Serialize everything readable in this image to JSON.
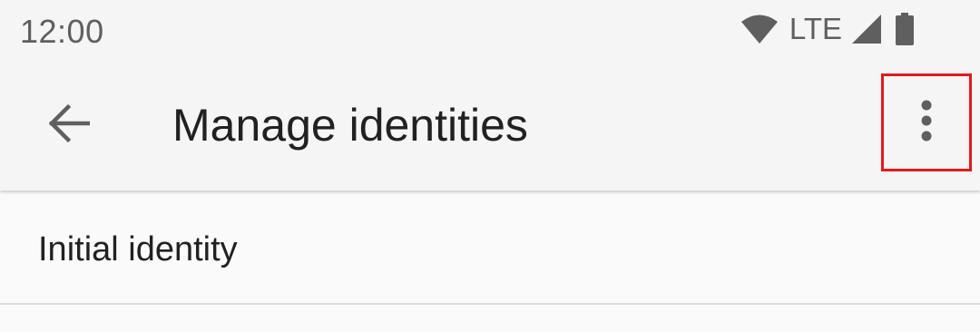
{
  "status_bar": {
    "time": "12:00",
    "network": "LTE",
    "icons": [
      "wifi-icon",
      "signal-icon",
      "battery-icon"
    ]
  },
  "app_bar": {
    "title": "Manage identities",
    "back_icon": "arrow-back-icon",
    "overflow_icon": "more-vert-icon"
  },
  "identities": [
    {
      "label": "Initial identity"
    }
  ],
  "colors": {
    "background": "#f5f5f5",
    "text_primary": "#212121",
    "text_secondary": "#5f5f5f",
    "highlight_box": "#e51919"
  }
}
